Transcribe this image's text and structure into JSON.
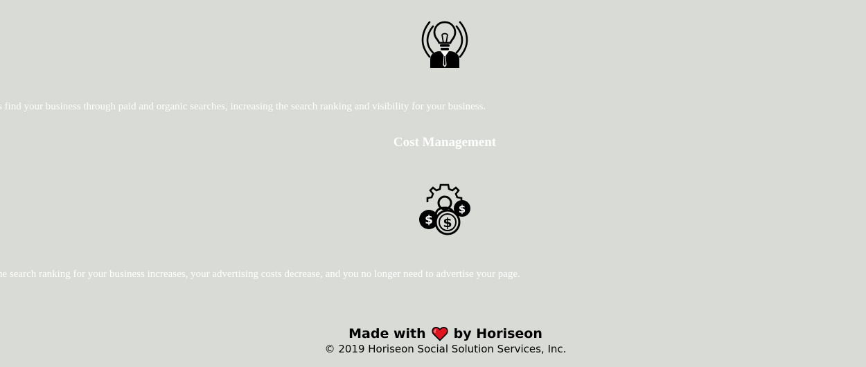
{
  "seo": {
    "icon": "lightbulb-head-businessman-icon",
    "text": "s find your business through paid and organic searches, increasing the search ranking and visibility for your business."
  },
  "cost_management": {
    "heading": "Cost Management",
    "icon": "money-gear-person-icon",
    "text": "he search ranking for your business increases, your advertising costs decrease, and you no longer need to advertise your page."
  },
  "footer": {
    "made_with": "Made with",
    "by": "by Horiseon",
    "copyright": "© 2019 Horiseon Social Solution Services, Inc.",
    "heart_icon": "heart-icon"
  },
  "colors": {
    "background": "#d9dbd6",
    "body_text": "#ffffff",
    "footer_text": "#000000",
    "heart": "#e0141e"
  }
}
